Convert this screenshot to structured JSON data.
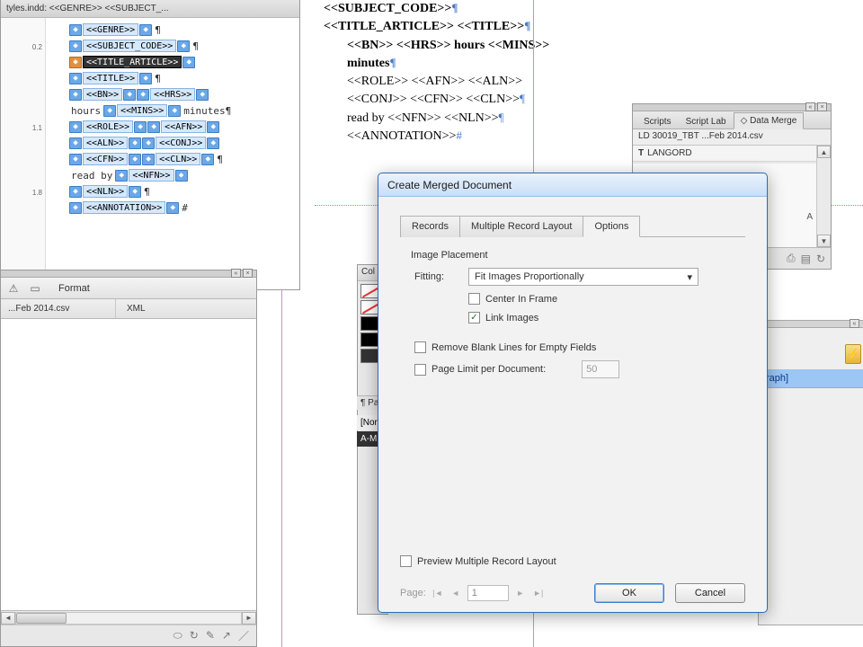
{
  "structure_panel": {
    "title_fragment": "tyles.indd: <<GENRE>> <<SUBJECT_...",
    "ruler_ticks": [
      "0.2",
      "1.1",
      "1.8"
    ],
    "rows": [
      {
        "type": "tag",
        "name": "GENRE",
        "trail": "¶"
      },
      {
        "type": "tag",
        "name": "SUBJECT_CODE",
        "trail": "¶"
      },
      {
        "type": "tag",
        "name": "TITLE_ARTICLE",
        "selected": true,
        "trail": ""
      },
      {
        "type": "tag",
        "name": "TITLE",
        "trail": "¶"
      },
      {
        "type": "pair",
        "a": "BN",
        "b": "HRS",
        "trail": ""
      },
      {
        "type": "text",
        "text": "hours",
        "b": "MINS",
        "trail": "minutes¶"
      },
      {
        "type": "pair",
        "a": "ROLE",
        "b": "AFN",
        "trail": ""
      },
      {
        "type": "pair",
        "a": "ALN",
        "b": "CONJ",
        "trail": ""
      },
      {
        "type": "pair",
        "a": "CFN",
        "b": "CLN",
        "trail": "¶"
      },
      {
        "type": "lead",
        "lead": "read by",
        "b": "NFN",
        "trail": ""
      },
      {
        "type": "tag",
        "name": "NLN",
        "trail": "¶"
      },
      {
        "type": "tag",
        "name": "ANNOTATION",
        "trail": "#"
      }
    ]
  },
  "page": {
    "lines": [
      {
        "text": "<<SUBJECT_CODE>>",
        "bold": true,
        "end": "¶"
      },
      {
        "text": "<<TITLE_ARTICLE>> <<TITLE>>",
        "bold": true,
        "end": "¶"
      },
      {
        "text": "<<BN>> <<HRS>> hours <<MINS>>",
        "indent": 1,
        "bold": true
      },
      {
        "text": "minutes",
        "indent": 1,
        "bold": true,
        "end": "¶"
      },
      {
        "text": "<<ROLE>> <<AFN>> <<ALN>>",
        "indent": 1
      },
      {
        "text": "<<CONJ>> <<CFN>> <<CLN>>",
        "indent": 1,
        "end": "¶"
      },
      {
        "text": "read by <<NFN>> <<NLN>>",
        "indent": 1,
        "end": "¶"
      },
      {
        "text": "<<ANNOTATION>>",
        "indent": 1,
        "end": "#"
      }
    ]
  },
  "files_panel": {
    "format_label": "Format",
    "col1": "...Feb 2014.csv",
    "col2": "XML"
  },
  "color_panel": {
    "header": "Col",
    "paragraph_header": "¶ Pa",
    "item_none": "[Non",
    "item_sel": "A-M"
  },
  "data_merge": {
    "tabs": [
      "Scripts",
      "Script Lab",
      "Data Merge"
    ],
    "active_tab": 2,
    "file": "LD 30019_TBT ...Feb 2014.csv",
    "field": "LANGORD",
    "single_letter": "A"
  },
  "right_panel": {
    "item": "raph]"
  },
  "dialog": {
    "title": "Create Merged Document",
    "tabs": [
      "Records",
      "Multiple Record Layout",
      "Options"
    ],
    "active_tab": 2,
    "section_image": "Image Placement",
    "fitting_label": "Fitting:",
    "fitting_value": "Fit Images Proportionally",
    "center_label": "Center In Frame",
    "link_label": "Link Images",
    "link_checked": true,
    "remove_blank": "Remove Blank Lines for Empty Fields",
    "page_limit": "Page Limit per Document:",
    "page_limit_value": "50",
    "preview_label": "Preview Multiple Record Layout",
    "page_label": "Page:",
    "page_value": "1",
    "ok": "OK",
    "cancel": "Cancel"
  }
}
